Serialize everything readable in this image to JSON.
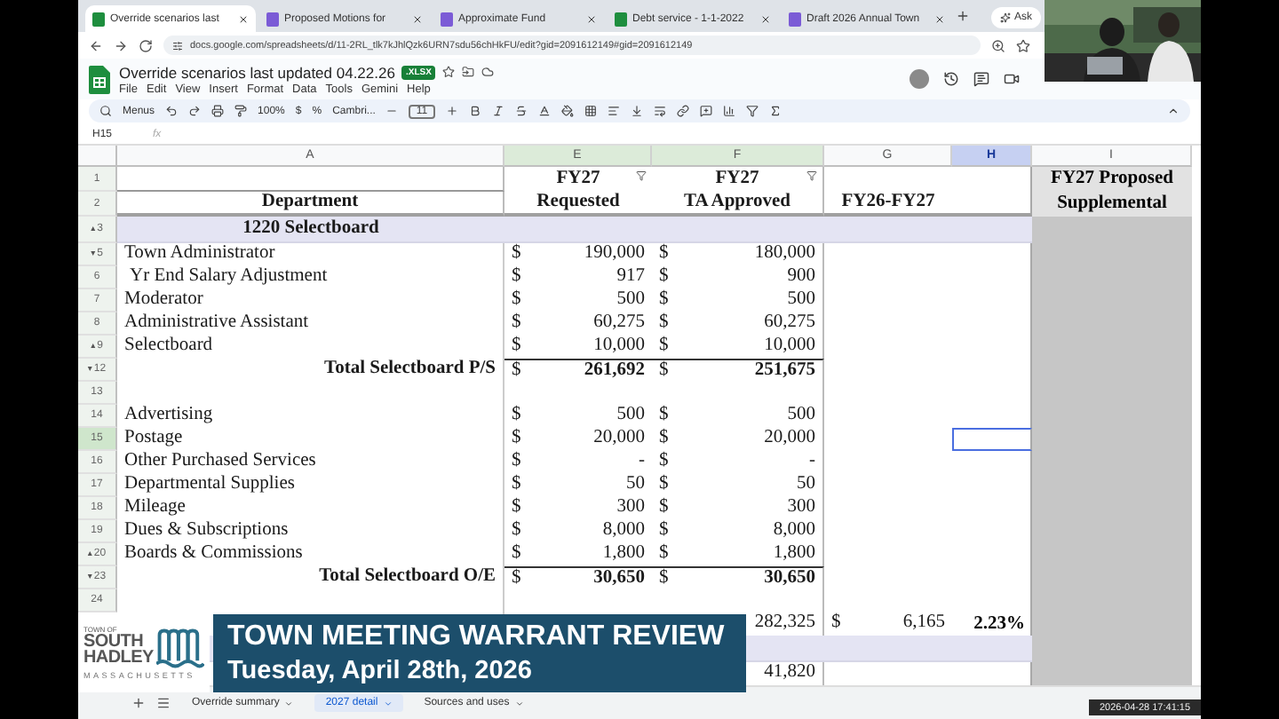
{
  "browser": {
    "tabs": [
      {
        "title": "Override scenarios last",
        "selected": true,
        "color": "#1e8e3e"
      },
      {
        "title": "Proposed Motions for",
        "selected": false,
        "color": "#7b5bd6"
      },
      {
        "title": "Approximate Fund",
        "selected": false,
        "color": "#7b5bd6"
      },
      {
        "title": "Debt service - 1-1-2022",
        "selected": false,
        "color": "#1e8e3e"
      },
      {
        "title": "Draft 2026 Annual Town",
        "selected": false,
        "color": "#7b5bd6"
      }
    ],
    "ask_button": "Ask",
    "url": "docs.google.com/spreadsheets/d/11-2RL_tlk7kJhlQzk6URN7sdu56chHkFU/edit?gid=2091612149#gid=2091612149"
  },
  "doc": {
    "title": "Override scenarios last updated 04.22.26",
    "badge": ".XLSX",
    "menu": [
      "File",
      "Edit",
      "View",
      "Insert",
      "Format",
      "Data",
      "Tools",
      "Gemini",
      "Help"
    ]
  },
  "toolbar": {
    "search": "Menus",
    "zoom": "100%",
    "currency": "$",
    "percent": "%",
    "font": "Cambri...",
    "font_size": "11"
  },
  "formula_bar": {
    "cell": "H15",
    "fx": "fx"
  },
  "columns": [
    {
      "label": "A",
      "selected": false,
      "shaded": false
    },
    {
      "label": "E",
      "selected": false,
      "shaded": true
    },
    {
      "label": "F",
      "selected": false,
      "shaded": true
    },
    {
      "label": "G",
      "selected": false,
      "shaded": false
    },
    {
      "label": "H",
      "selected": true,
      "shaded": false
    },
    {
      "label": "I",
      "selected": false,
      "shaded": false
    }
  ],
  "rows": [
    {
      "num": "1",
      "kind": "header",
      "selected": false,
      "e": "FY27",
      "e_filter": true,
      "f": "FY27",
      "f_filter": true,
      "i": "FY27 Proposed"
    },
    {
      "num": "2",
      "kind": "header",
      "selected": false,
      "a": "Department",
      "e": "Requested",
      "f": "TA Approved",
      "g": "FY26-FY27",
      "i": "Supplemental"
    },
    {
      "num": "3",
      "marker": "▴",
      "kind": "section",
      "selected": false,
      "a": "1220 Selectboard"
    },
    {
      "num": "5",
      "marker": "▾",
      "kind": "item",
      "selected": false,
      "a": "Town Administrator",
      "e_sign": "$",
      "e": "190,000",
      "f_sign": "$",
      "f": "180,000"
    },
    {
      "num": "6",
      "kind": "item",
      "selected": false,
      "indented": true,
      "a": "Yr End Salary Adjustment",
      "e_sign": "$",
      "e": "917",
      "f_sign": "$",
      "f": "900"
    },
    {
      "num": "7",
      "kind": "item",
      "selected": false,
      "a": "Moderator",
      "e_sign": "$",
      "e": "500",
      "f_sign": "$",
      "f": "500"
    },
    {
      "num": "8",
      "kind": "item",
      "selected": false,
      "a": "Administrative Assistant",
      "e_sign": "$",
      "e": "60,275",
      "f_sign": "$",
      "f": "60,275"
    },
    {
      "num": "9",
      "marker": "▴",
      "kind": "item",
      "selected": false,
      "a": "Selectboard",
      "e_sign": "$",
      "e": "10,000",
      "f_sign": "$",
      "f": "10,000"
    },
    {
      "num": "12",
      "marker": "▾",
      "kind": "total",
      "selected": false,
      "a": "Total Selectboard P/S",
      "e_sign": "$",
      "e": "261,692",
      "f_sign": "$",
      "f": "251,675"
    },
    {
      "num": "13",
      "kind": "blank",
      "selected": false
    },
    {
      "num": "14",
      "kind": "item",
      "selected": false,
      "a": "Advertising",
      "e_sign": "$",
      "e": "500",
      "f_sign": "$",
      "f": "500"
    },
    {
      "num": "15",
      "kind": "item",
      "selected": true,
      "a": "Postage",
      "e_sign": "$",
      "e": "20,000",
      "f_sign": "$",
      "f": "20,000"
    },
    {
      "num": "16",
      "kind": "item",
      "selected": false,
      "a": "Other Purchased Services",
      "e_sign": "$",
      "e": "-",
      "f_sign": "$",
      "f": "-"
    },
    {
      "num": "17",
      "kind": "item",
      "selected": false,
      "a": "Departmental Supplies",
      "e_sign": "$",
      "e": "50",
      "f_sign": "$",
      "f": "50"
    },
    {
      "num": "18",
      "kind": "item",
      "selected": false,
      "a": "Mileage",
      "e_sign": "$",
      "e": "300",
      "f_sign": "$",
      "f": "300"
    },
    {
      "num": "19",
      "kind": "item",
      "selected": false,
      "a": "Dues & Subscriptions",
      "e_sign": "$",
      "e": "8,000",
      "f_sign": "$",
      "f": "8,000"
    },
    {
      "num": "20",
      "marker": "▴",
      "kind": "item",
      "selected": false,
      "a": "Boards & Commissions",
      "e_sign": "$",
      "e": "1,800",
      "f_sign": "$",
      "f": "1,800"
    },
    {
      "num": "23",
      "marker": "▾",
      "kind": "total",
      "selected": false,
      "a": "Total Selectboard O/E",
      "e_sign": "$",
      "e": "30,650",
      "f_sign": "$",
      "f": "30,650"
    },
    {
      "num": "24",
      "kind": "blank",
      "selected": false
    },
    {
      "kind": "total",
      "f": "282,325",
      "g_sign": "$",
      "g": "6,165",
      "h": "2.23%"
    },
    {
      "kind": "section"
    },
    {
      "kind": "item",
      "f": "41,820"
    }
  ],
  "sheet_tabs": [
    {
      "label": "Override summary",
      "selected": false
    },
    {
      "label": "2027 detail",
      "selected": true
    },
    {
      "label": "Sources and uses",
      "selected": false
    }
  ],
  "overlay": {
    "logo": {
      "line_1": "TOWN OF",
      "line_2": "SOUTH",
      "line_3": "HADLEY",
      "line_4": "MASSACHUSETTS"
    },
    "title": "TOWN MEETING WARRANT REVIEW",
    "subtitle": "Tuesday, April 28th, 2026"
  },
  "timestamp": "2026-04-28 17:41:15"
}
